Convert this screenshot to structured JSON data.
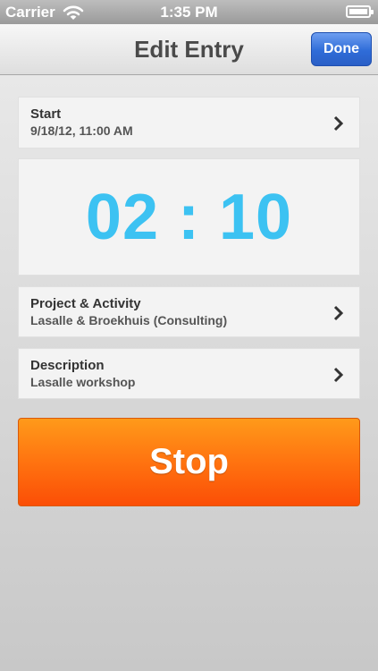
{
  "status_bar": {
    "carrier": "Carrier",
    "time": "1:35 PM"
  },
  "nav": {
    "title": "Edit Entry",
    "done_label": "Done"
  },
  "start": {
    "label": "Start",
    "value": "9/18/12, 11:00 AM"
  },
  "timer": {
    "display": "02 : 10"
  },
  "project": {
    "label": "Project & Activity",
    "value": "Lasalle & Broekhuis (Consulting)"
  },
  "description": {
    "label": "Description",
    "value": "Lasalle workshop"
  },
  "stop_label": "Stop",
  "colors": {
    "timer": "#3cc2f2",
    "accent_blue": "#2f6cd8",
    "stop_orange": "#ff7310"
  },
  "icons": {
    "wifi": "wifi-icon",
    "battery": "battery-icon",
    "chevron": "chevron-right-icon"
  }
}
